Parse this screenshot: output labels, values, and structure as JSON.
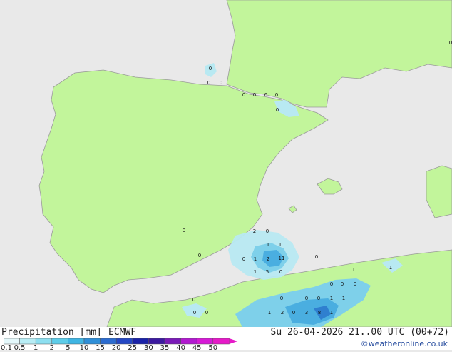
{
  "map": {
    "colors": {
      "sea": "#e9e9e9",
      "land": "#c2f59b",
      "precip_light": "#b8e9f2",
      "precip_medium": "#7ed0ea",
      "precip_heavy": "#4aaee0",
      "precip_strong": "#2f7fcf"
    },
    "station_values": [
      "0",
      "0",
      "0",
      "0",
      "0",
      "0",
      "0",
      "0",
      "0",
      "0",
      "2",
      "0",
      "1",
      "1",
      "0",
      "1",
      "2",
      "11",
      "0",
      "1",
      "5",
      "0",
      "1",
      "1",
      "0",
      "0",
      "0",
      "1",
      "1",
      "0",
      "1",
      "2",
      "0",
      "3",
      "8",
      "1",
      "0",
      "0",
      "0",
      "0",
      "0",
      "0"
    ]
  },
  "footer": {
    "title": "Precipitation [mm]",
    "model": "ECMWF",
    "datetime": "Su 26-04-2026 21..00 UTC (00+72)",
    "copyright": "©weatheronline.co.uk",
    "legend": {
      "ticks": [
        "0.1",
        "0.5",
        "1",
        "2",
        "5",
        "10",
        "15",
        "20",
        "25",
        "30",
        "35",
        "40",
        "45",
        "50"
      ],
      "colors": [
        "#e4f8fb",
        "#b8edf5",
        "#8ddff0",
        "#5ecde9",
        "#3fb5e3",
        "#2f8fd8",
        "#2c6cd0",
        "#2447c4",
        "#1a22a8",
        "#3c1aa0",
        "#7a1ab8",
        "#b21ad0",
        "#d61ad6",
        "#e61ac8"
      ]
    }
  }
}
